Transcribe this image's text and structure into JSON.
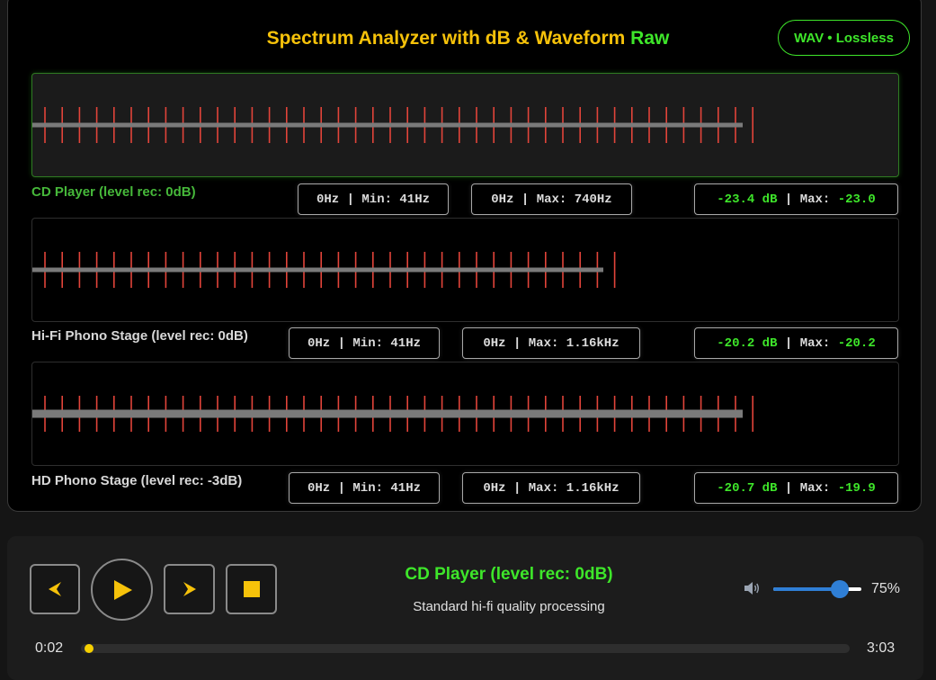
{
  "header": {
    "title_main": "Spectrum Analyzer with dB & Waveform",
    "title_accent": "Raw",
    "badge": "WAV • Lossless"
  },
  "lanes": [
    {
      "label": "CD Player (level rec: 0dB)",
      "min_chip": "0Hz | Min: 41Hz",
      "max_chip": "0Hz | Max: 740Hz",
      "db_value": "-23.4 dB",
      "db_sep": " | ",
      "db_max_label": "Max: ",
      "db_max": "-23.0",
      "active": true
    },
    {
      "label": "Hi-Fi Phono Stage (level rec: 0dB)",
      "min_chip": "0Hz | Min: 41Hz",
      "max_chip": "0Hz | Max: 1.16kHz",
      "db_value": "-20.2 dB",
      "db_sep": " | ",
      "db_max_label": "Max: ",
      "db_max": "-20.2",
      "active": false
    },
    {
      "label": "HD Phono Stage (level rec: -3dB)",
      "min_chip": "0Hz | Min: 41Hz",
      "max_chip": "0Hz | Max: 1.16kHz",
      "db_value": "-20.7 dB",
      "db_sep": " | ",
      "db_max_label": "Max: ",
      "db_max": "-19.9",
      "active": false
    }
  ],
  "player": {
    "now_title": "CD Player (level rec: 0dB)",
    "now_desc": "Standard hi-fi quality processing",
    "volume_pct_label": "75%",
    "volume": 0.75,
    "elapsed": "0:02",
    "duration": "3:03",
    "progress": 0.011,
    "buttons": [
      "previous-icon",
      "play-icon",
      "next-icon",
      "stop-icon"
    ]
  },
  "colors": {
    "accent_yellow": "#f6c20a",
    "accent_green": "#3ee62a",
    "tick_red": "#e2443a",
    "slider_blue": "#2f7fd6"
  }
}
